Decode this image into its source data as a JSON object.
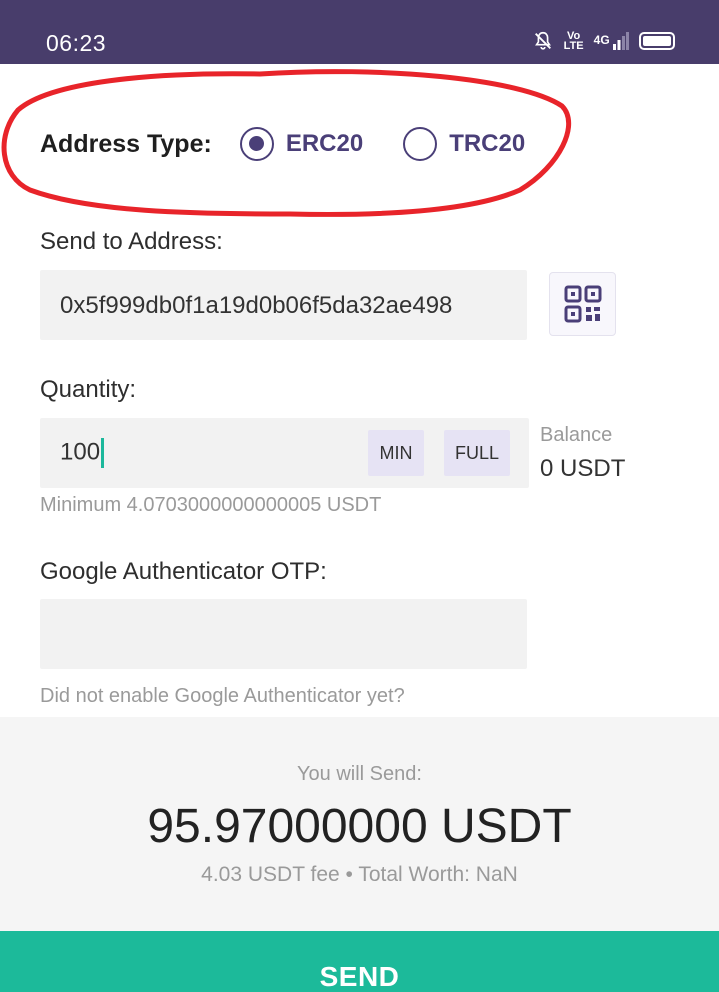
{
  "status_bar": {
    "time": "06:23",
    "network_label": "4G",
    "volte_top": "Vo",
    "volte_bottom": "LTE",
    "icons": [
      "bell-off-icon",
      "volte-icon",
      "signal-icon",
      "battery-icon"
    ]
  },
  "address_type": {
    "label": "Address Type:",
    "options": [
      {
        "label": "ERC20",
        "selected": true
      },
      {
        "label": "TRC20",
        "selected": false
      }
    ]
  },
  "send_to": {
    "label": "Send to Address:",
    "value": "0x5f999db0f1a19d0b06f5da32ae498",
    "qr_icon": "qr-code-icon"
  },
  "quantity": {
    "label": "Quantity:",
    "value": "100",
    "min_label": "MIN",
    "full_label": "FULL",
    "balance_label": "Balance",
    "balance_value": "0 USDT",
    "minimum_note": "Minimum 4.0703000000000005 USDT"
  },
  "otp": {
    "label": "Google Authenticator OTP:",
    "value": "",
    "note": "Did not enable Google Authenticator yet?"
  },
  "summary": {
    "label": "You will Send:",
    "amount": "95.97000000 USDT",
    "fee": "4.03 USDT fee • Total Worth: NaN"
  },
  "send_button": "SEND",
  "colors": {
    "status_bar": "#483d6b",
    "accent_purple": "#4a3f78",
    "send_green": "#1cba9a",
    "annotation_red": "#e8242a"
  }
}
